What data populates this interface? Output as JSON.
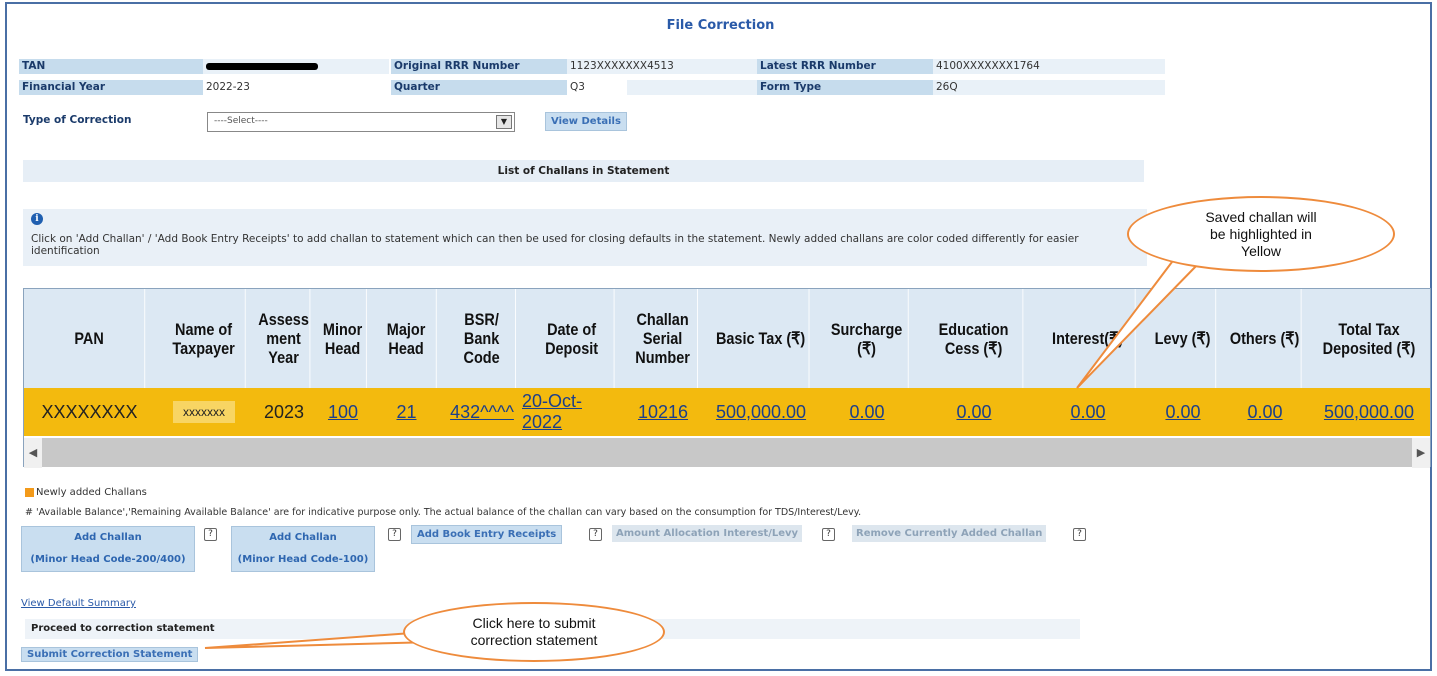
{
  "page": {
    "title": "File Correction"
  },
  "header": {
    "tan_label": "TAN",
    "orig_rrr_label": "Original RRR Number",
    "orig_rrr_value": "1123XXXXXXX4513",
    "latest_rrr_label": "Latest RRR Number",
    "latest_rrr_value": "4100XXXXXXX1764",
    "fy_label": "Financial Year",
    "fy_value": "2022-23",
    "quarter_label": "Quarter",
    "quarter_value": "Q3",
    "form_type_label": "Form Type",
    "form_type_value": "26Q"
  },
  "correction": {
    "type_label": "Type of Correction",
    "select_value": "----Select----",
    "view_details": "View Details"
  },
  "list_title": "List of Challans in Statement",
  "info": {
    "text": "Click on 'Add Challan' / 'Add Book Entry Receipts' to add challan to statement which can then be used for closing defaults in the statement. Newly added challans are color coded differently for easier identification"
  },
  "table": {
    "headers": [
      "PAN",
      "Name of Taxpayer",
      "Assess ment Year",
      "Minor Head",
      "Major Head",
      "BSR/ Bank Code",
      "Date of Deposit",
      "Challan Serial Number",
      "Basic Tax (₹)",
      "Surcharge (₹)",
      "Education Cess (₹)",
      "Interest(₹)",
      "Levy (₹)",
      "Others (₹)",
      "Total Tax Deposited (₹)"
    ],
    "row": [
      "XXXXXXXX",
      "xxxxxxx",
      "2023",
      "100",
      "21",
      "432^^^^",
      "20-Oct-2022",
      "10216",
      "500,000.00",
      "0.00",
      "0.00",
      "0.00",
      "0.00",
      "0.00",
      "500,000.00"
    ]
  },
  "highlight_color": "#f3ba0e",
  "legend": {
    "text": "Newly added Challans",
    "color": "#f39a1a"
  },
  "note": "# 'Available Balance','Remaining Available Balance' are for indicative purpose only. The actual balance of the challan can vary based on the consumption for TDS/Interest/Levy.",
  "buttons": {
    "add_challan_1": "Add Challan",
    "add_challan_1_sub": "(Minor Head Code-200/400)",
    "add_challan_2": "Add Challan",
    "add_challan_2_sub": "(Minor Head Code-100)",
    "add_book_entry": "Add Book Entry Receipts",
    "amount_allocation": "Amount Allocation Interest/Levy",
    "remove_challan": "Remove Currently Added Challan",
    "help": "?"
  },
  "footer": {
    "view_default_summary": "View Default Summary",
    "proceed": "Proceed to correction statement",
    "submit": "Submit Correction Statement"
  },
  "callouts": {
    "saved": "Saved challan will be highlighted in Yellow",
    "submit": "Click here to submit correction statement"
  }
}
